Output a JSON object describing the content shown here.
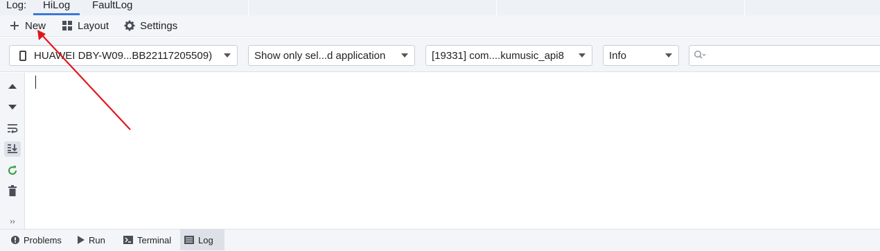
{
  "tabs": {
    "prefix": "Log:",
    "items": [
      {
        "label": "HiLog",
        "active": true
      },
      {
        "label": "FaultLog",
        "active": false
      }
    ]
  },
  "actions": {
    "new_label": "New",
    "layout_label": "Layout",
    "settings_label": "Settings"
  },
  "filters": {
    "device": "HUAWEI DBY-W09...BB22117205509)",
    "app_filter": "Show only sel...d application",
    "process": "[19331] com....kumusic_api8",
    "level": "Info",
    "search_value": ""
  },
  "gutter_icons": [
    "scroll-up-icon",
    "scroll-down-icon",
    "soft-wrap-icon",
    "scroll-to-end-icon",
    "restart-icon",
    "clear-icon",
    "more-icon"
  ],
  "bottom_tabs": [
    {
      "label": "Problems",
      "icon": "info-circle-icon",
      "active": false
    },
    {
      "label": "Run",
      "icon": "play-icon",
      "active": false
    },
    {
      "label": "Terminal",
      "icon": "terminal-icon",
      "active": false
    },
    {
      "label": "Log",
      "icon": "log-icon",
      "active": true
    }
  ],
  "colors": {
    "accent": "#3b78d8",
    "annotation_arrow": "#e0161d"
  }
}
